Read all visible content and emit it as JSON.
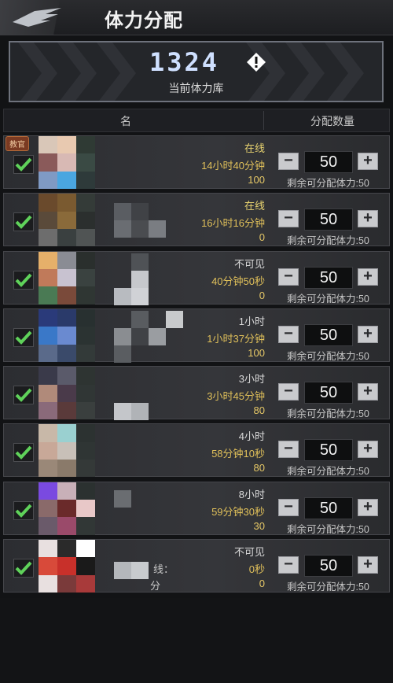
{
  "header": {
    "title": "体力分配",
    "logo_icon": "eagle-wing-icon"
  },
  "bank": {
    "value": "1324",
    "label": "当前体力库",
    "info_icon": "exclamation-icon"
  },
  "columns": {
    "name": "名",
    "allocate": "分配数量"
  },
  "rows": [
    {
      "badge": "教官",
      "status": "在线",
      "status_type": "online",
      "timer": "14小时40分钟",
      "stamina": "100",
      "qty": "50",
      "remain": "剩余可分配体力:50",
      "checked": true
    },
    {
      "status": "在线",
      "status_type": "online",
      "timer": "16小时16分钟",
      "stamina": "0",
      "qty": "50",
      "remain": "剩余可分配体力:50",
      "checked": true
    },
    {
      "status": "不可见",
      "status_type": "invisible",
      "timer": "40分钟50秒",
      "stamina": "0",
      "qty": "50",
      "remain": "剩余可分配体力:50",
      "checked": true
    },
    {
      "status": "1小时",
      "status_type": "invisible",
      "timer": "1小时37分钟",
      "stamina": "100",
      "qty": "50",
      "remain": "剩余可分配体力:50",
      "checked": true
    },
    {
      "status": "3小时",
      "status_type": "invisible",
      "timer": "3小时45分钟",
      "stamina": "80",
      "qty": "50",
      "remain": "剩余可分配体力:50",
      "checked": true
    },
    {
      "status": "4小时",
      "status_type": "invisible",
      "timer": "58分钟10秒",
      "stamina": "80",
      "qty": "50",
      "remain": "剩余可分配体力:50",
      "checked": true
    },
    {
      "status": "8小时",
      "status_type": "invisible",
      "timer": "59分钟30秒",
      "stamina": "30",
      "qty": "50",
      "remain": "剩余可分配体力:50",
      "checked": true
    },
    {
      "status": "不可见",
      "status_type": "invisible",
      "timer": "0秒",
      "stamina": "0",
      "qty": "50",
      "remain": "剩余可分配体力:50",
      "checked": true,
      "extra_1": "线：",
      "extra_2": "分"
    }
  ],
  "controls": {
    "minus_symbol": "−",
    "plus_symbol": "+"
  },
  "colors": {
    "accent_gold": "#e0c05a",
    "check_green": "#5fd25a",
    "bank_border": "#6e727c"
  }
}
